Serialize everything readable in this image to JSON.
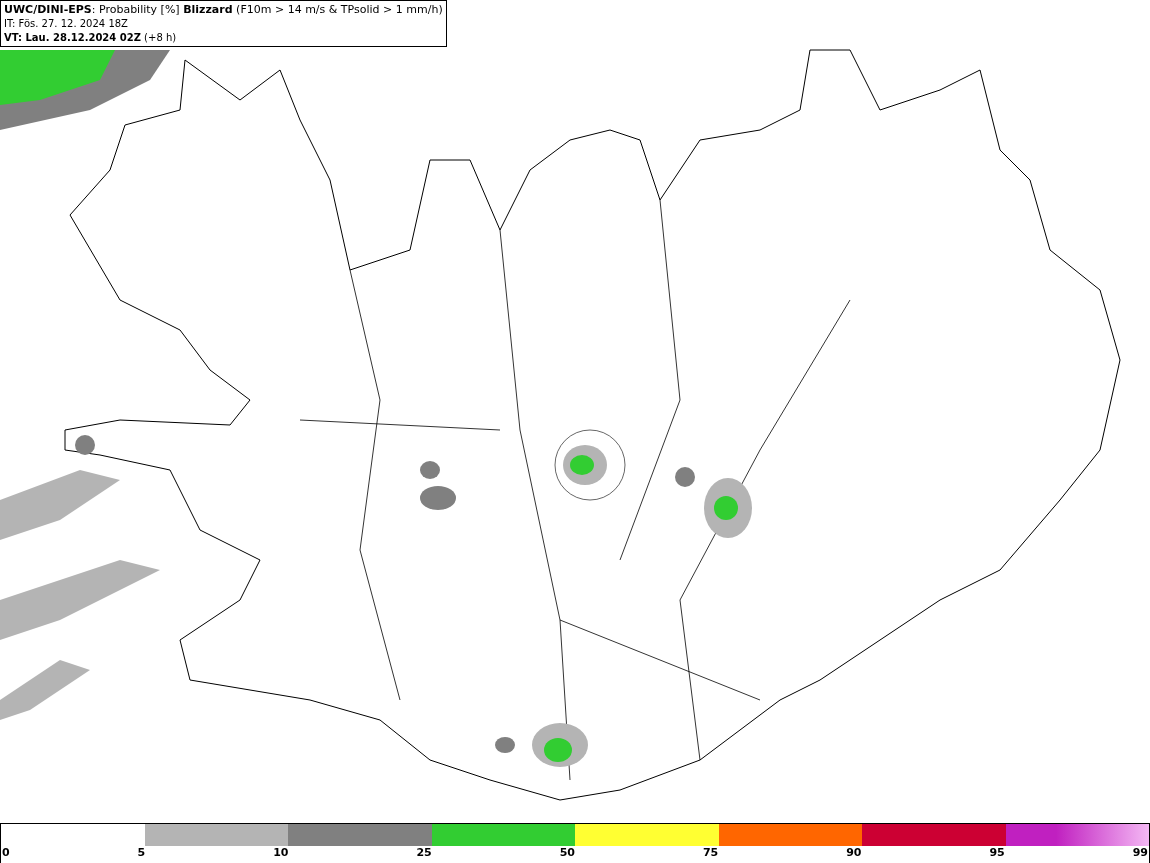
{
  "header": {
    "title": "**UWC/DINI-EPS**: Probability [%] **Blizzard** (F10m > 14 m/s & TPsolid > 1 mm/h)",
    "init_time": "IT: Fös. 27. 12. 2024 18Z",
    "valid_time": "**VT: Lau. 28.12.2024 02Z** (+8 h)"
  },
  "legend": {
    "segments": [
      {
        "color": "#b4b4b4"
      },
      {
        "color": "#808080"
      },
      {
        "color": "#32cd32"
      },
      {
        "color": "#ffff32"
      },
      {
        "color": "#ff6600"
      },
      {
        "color": "#cc0033"
      },
      {
        "color": "#c020c0"
      }
    ],
    "labels": [
      "0",
      "5",
      "10",
      "25",
      "50",
      "75",
      "90",
      "95",
      "99"
    ]
  }
}
